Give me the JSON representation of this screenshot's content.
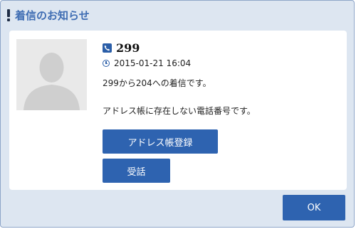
{
  "dialog": {
    "title": "着信のお知らせ",
    "title_icon": "exclamation-icon"
  },
  "caller": {
    "number": "299",
    "timestamp": "2015-01-21 16:04",
    "avatar_icon": "person-silhouette"
  },
  "messages": {
    "line1": "299から204への着信です。",
    "line2": "アドレス帳に存在しない電話番号です。"
  },
  "buttons": {
    "address_register": "アドレス帳登録",
    "answer": "受話",
    "ok": "OK"
  },
  "colors": {
    "accent": "#2e63b0",
    "title": "#3f6db3",
    "dialog_bg": "#dde6f1"
  }
}
